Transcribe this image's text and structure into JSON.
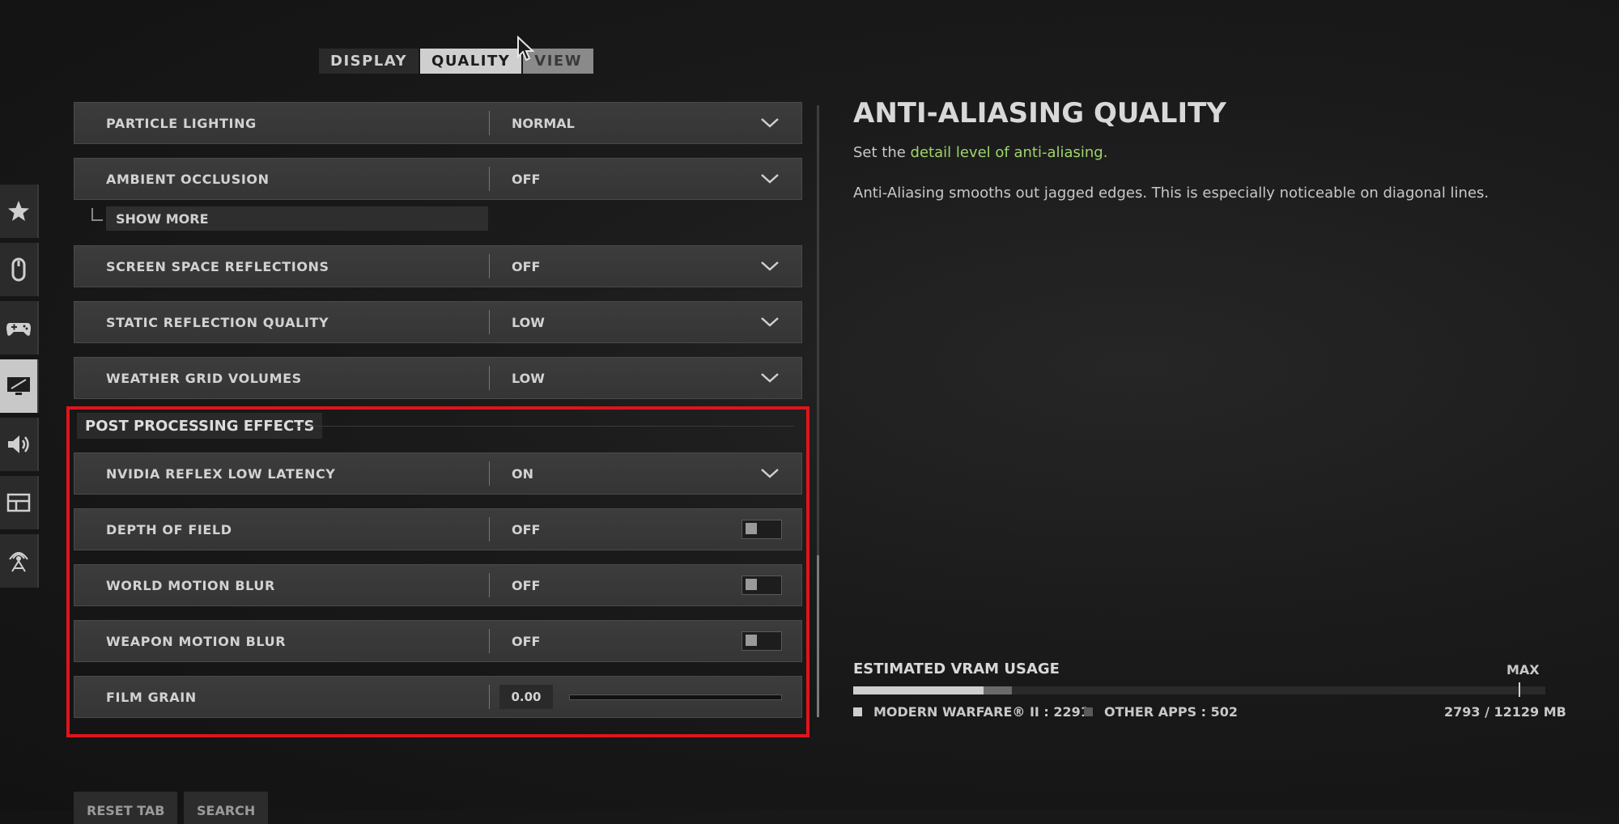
{
  "tabs": [
    {
      "label": "DISPLAY",
      "active": false
    },
    {
      "label": "QUALITY",
      "active": true
    },
    {
      "label": "VIEW",
      "active": false
    }
  ],
  "sidebar": {
    "items": [
      {
        "icon": "star-icon"
      },
      {
        "icon": "mouse-icon"
      },
      {
        "icon": "controller-icon"
      },
      {
        "icon": "monitor-icon",
        "active": true
      },
      {
        "icon": "speaker-icon"
      },
      {
        "icon": "interface-icon"
      },
      {
        "icon": "network-icon"
      }
    ]
  },
  "settings": {
    "particle_lighting": {
      "label": "PARTICLE LIGHTING",
      "value": "NORMAL"
    },
    "ambient_occlusion": {
      "label": "AMBIENT OCCLUSION",
      "value": "OFF"
    },
    "show_more": "SHOW MORE",
    "screen_space_reflections": {
      "label": "SCREEN SPACE REFLECTIONS",
      "value": "OFF"
    },
    "static_reflection_quality": {
      "label": "STATIC REFLECTION QUALITY",
      "value": "LOW"
    },
    "weather_grid_volumes": {
      "label": "WEATHER GRID VOLUMES",
      "value": "LOW"
    }
  },
  "post_processing": {
    "header": "POST PROCESSING EFFECTS",
    "nvidia_reflex": {
      "label": "NVIDIA REFLEX LOW LATENCY",
      "value": "ON"
    },
    "depth_of_field": {
      "label": "DEPTH OF FIELD",
      "value": "OFF"
    },
    "world_motion_blur": {
      "label": "WORLD MOTION BLUR",
      "value": "OFF"
    },
    "weapon_motion_blur": {
      "label": "WEAPON MOTION BLUR",
      "value": "OFF"
    },
    "film_grain": {
      "label": "FILM GRAIN",
      "value": "0.00"
    }
  },
  "detail": {
    "title": "ANTI-ALIASING QUALITY",
    "subtitle_prefix": "Set the ",
    "subtitle_highlight": "detail level of anti-aliasing.",
    "description": "Anti-Aliasing smooths out jagged edges. This is especially noticeable on diagonal lines."
  },
  "vram": {
    "title": "ESTIMATED VRAM USAGE",
    "max_label": "MAX",
    "mw_label": "MODERN WARFARE® II : 2291",
    "other_label": "OTHER APPS : 502",
    "total_label": "2793 / 12129 MB",
    "mw_mb": 2291,
    "other_mb": 502,
    "max_mb": 12129
  },
  "bottom": {
    "reset": "RESET TAB",
    "search": "SEARCH"
  },
  "colors": {
    "highlight": "#e0141b",
    "accent_text": "#9fd46a"
  }
}
